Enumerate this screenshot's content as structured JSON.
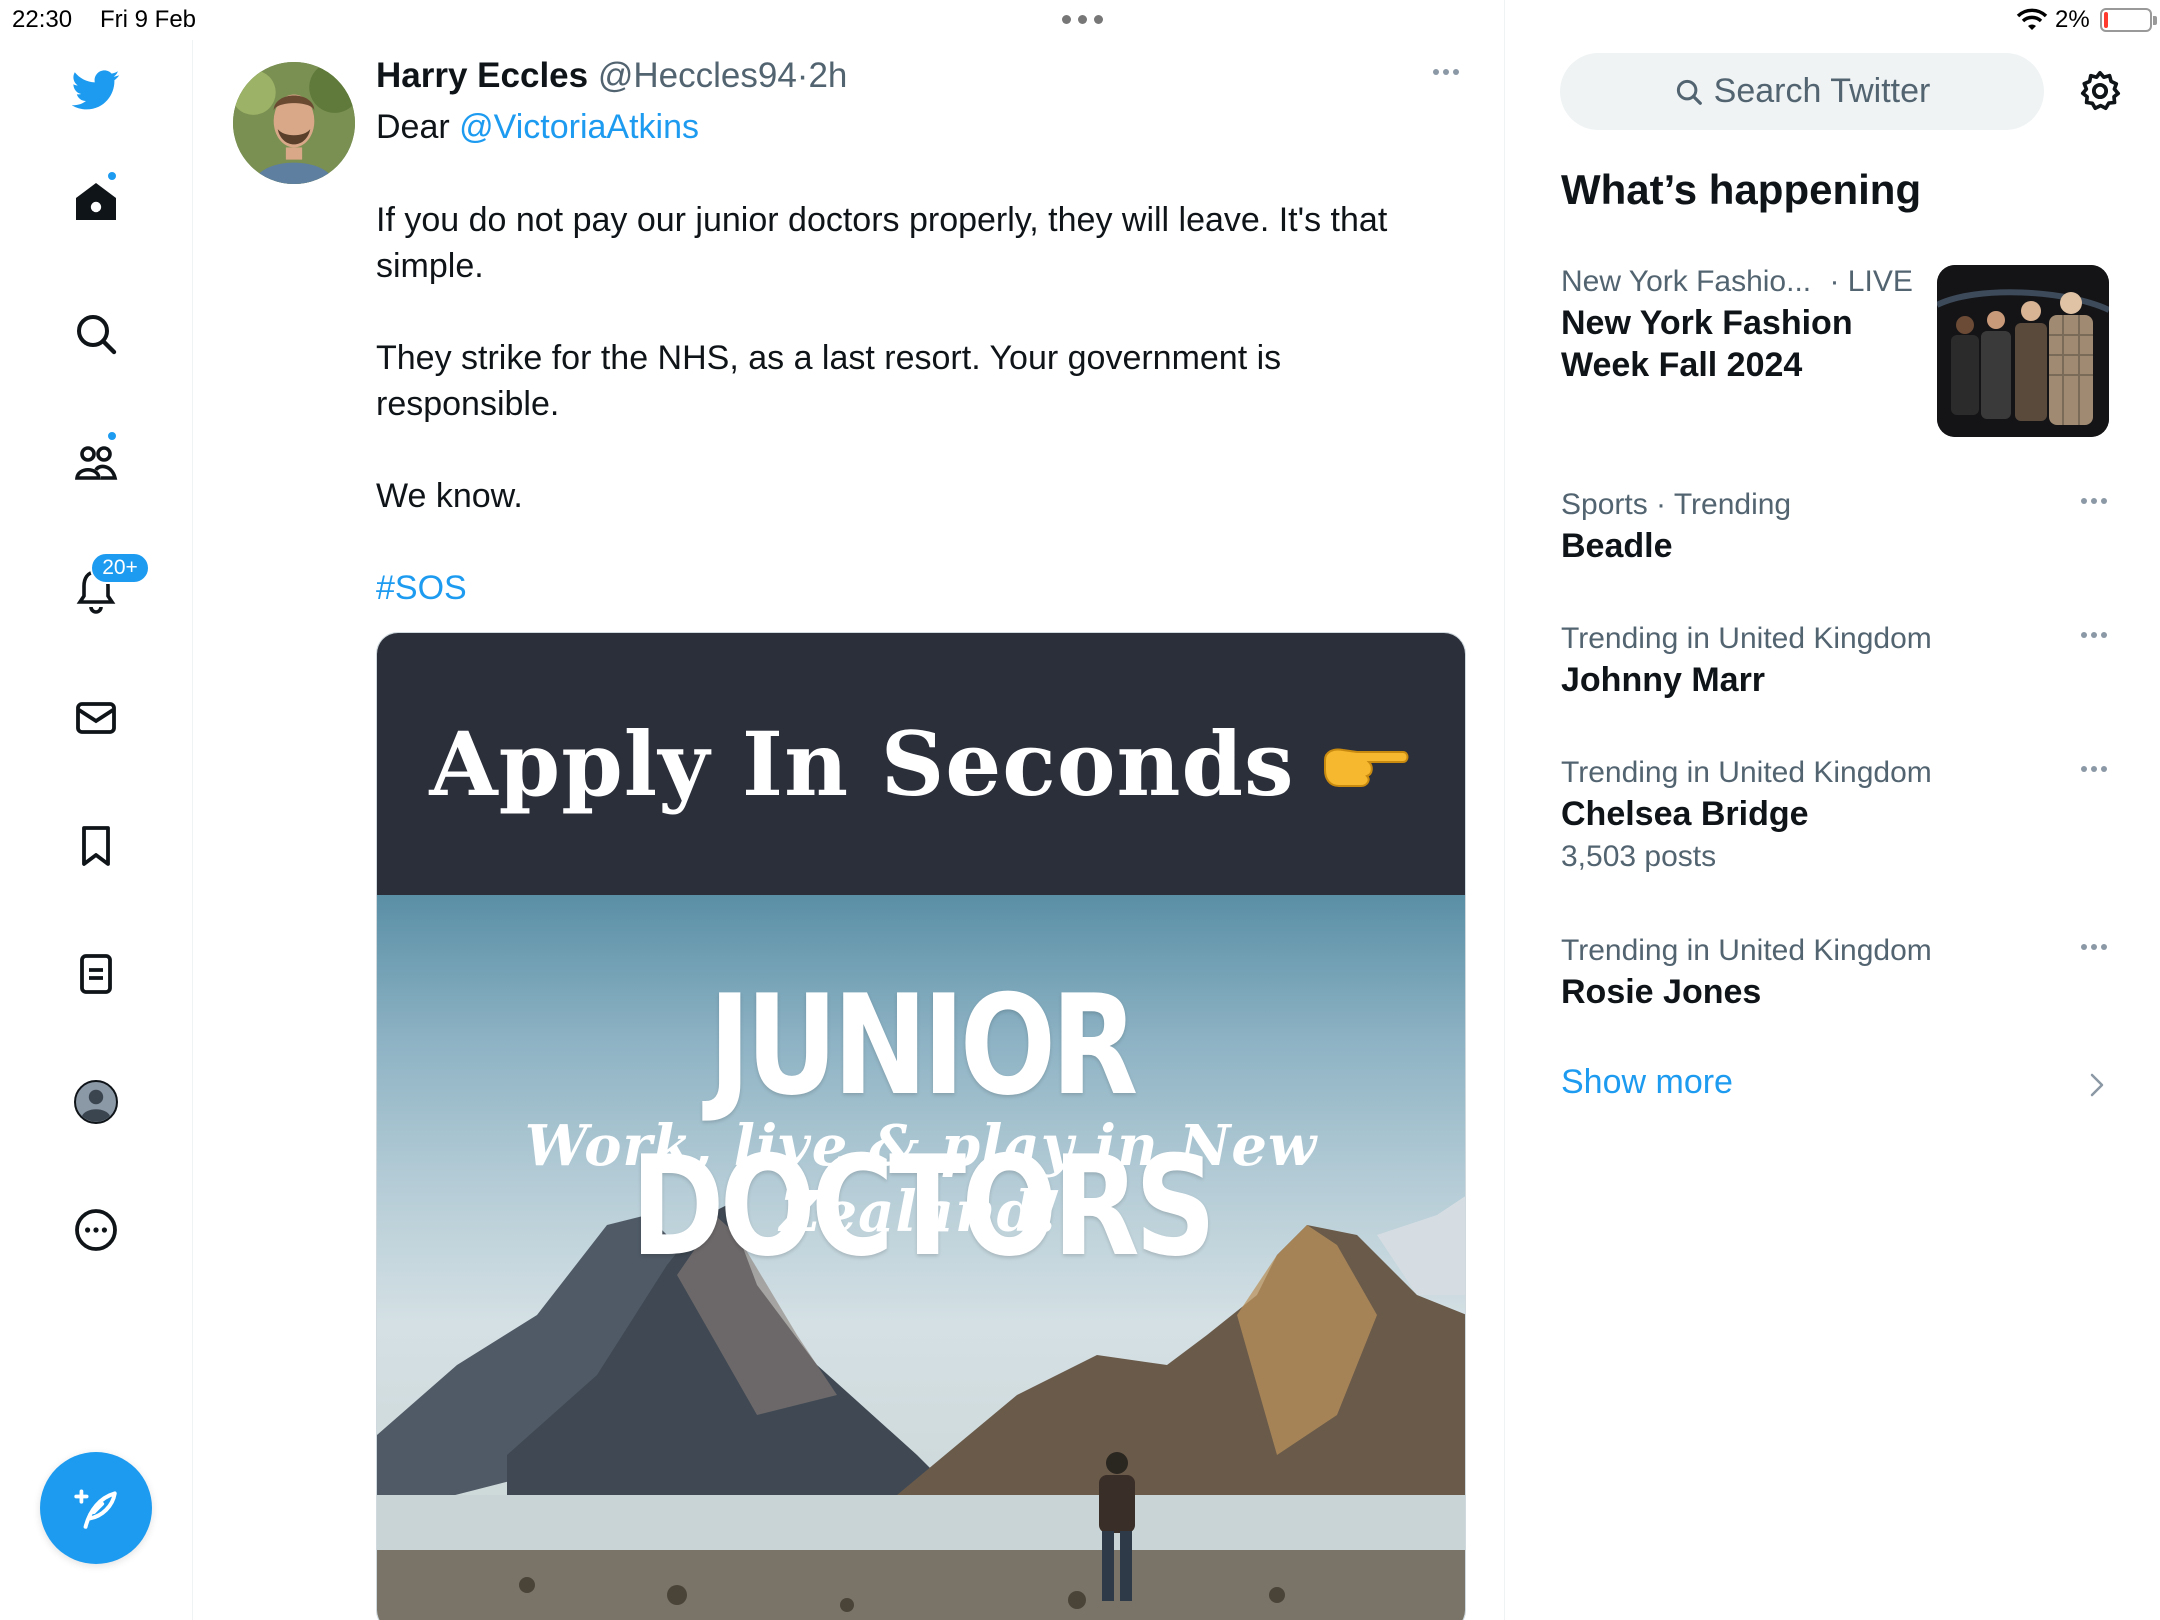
{
  "status_bar": {
    "time": "22:30",
    "date": "Fri 9 Feb",
    "battery_percent": "2%",
    "battery_level": 0.02
  },
  "sidebar": {
    "items": [
      {
        "name": "twitter-logo",
        "icon": "bird-icon"
      },
      {
        "name": "home",
        "icon": "home-icon",
        "has_dot": true
      },
      {
        "name": "explore",
        "icon": "search-icon"
      },
      {
        "name": "communities",
        "icon": "people-icon",
        "has_dot": true
      },
      {
        "name": "notifications",
        "icon": "bell-icon",
        "badge": "20+"
      },
      {
        "name": "messages",
        "icon": "mail-icon"
      },
      {
        "name": "bookmarks",
        "icon": "bookmark-icon"
      },
      {
        "name": "lists",
        "icon": "list-icon"
      },
      {
        "name": "profile",
        "icon": "profile-avatar-icon"
      },
      {
        "name": "more",
        "icon": "more-circle-icon"
      }
    ],
    "notifications_badge": "20+",
    "compose_icon": "compose-feather-icon"
  },
  "tweet": {
    "author_name": "Harry Eccles",
    "author_handle": "@Heccles94",
    "separator": "·",
    "time": "2h",
    "greeting": "Dear ",
    "mention": "@VictoriaAtkins",
    "paragraph_1": "If you do not pay our junior doctors properly, they will leave. It's that simple.",
    "paragraph_2": "They strike for the NHS, as a last resort. Your government is responsible.",
    "paragraph_3": "We know.",
    "hashtag": "#SOS",
    "media": {
      "banner_text": "Apply In Seconds",
      "banner_icon": "pointing-hand-emoji",
      "title": "JUNIOR DOCTORS",
      "subtitle": "Work, live & play in New Zealand!"
    }
  },
  "right_column": {
    "search_placeholder": "Search Twitter",
    "section_title": "What’s happening",
    "trends": [
      {
        "meta": "New York Fashio...",
        "meta_suffix": "· LIVE",
        "title_line1": "New York Fashion",
        "title_line2": "Week Fall 2024"
      },
      {
        "meta": "Sports · Trending",
        "title": "Beadle"
      },
      {
        "meta": "Trending in United Kingdom",
        "title": "Johnny Marr"
      },
      {
        "meta": "Trending in United Kingdom",
        "title": "Chelsea Bridge",
        "count": "3,503 posts"
      },
      {
        "meta": "Trending in United Kingdom",
        "title": "Rosie Jones"
      }
    ],
    "show_more": "Show more"
  },
  "colors": {
    "accent": "#1d9bf0",
    "text_primary": "#0f1419",
    "text_secondary": "#536471",
    "search_bg": "#eff3f4",
    "banner_bg": "#2b2f3a"
  }
}
